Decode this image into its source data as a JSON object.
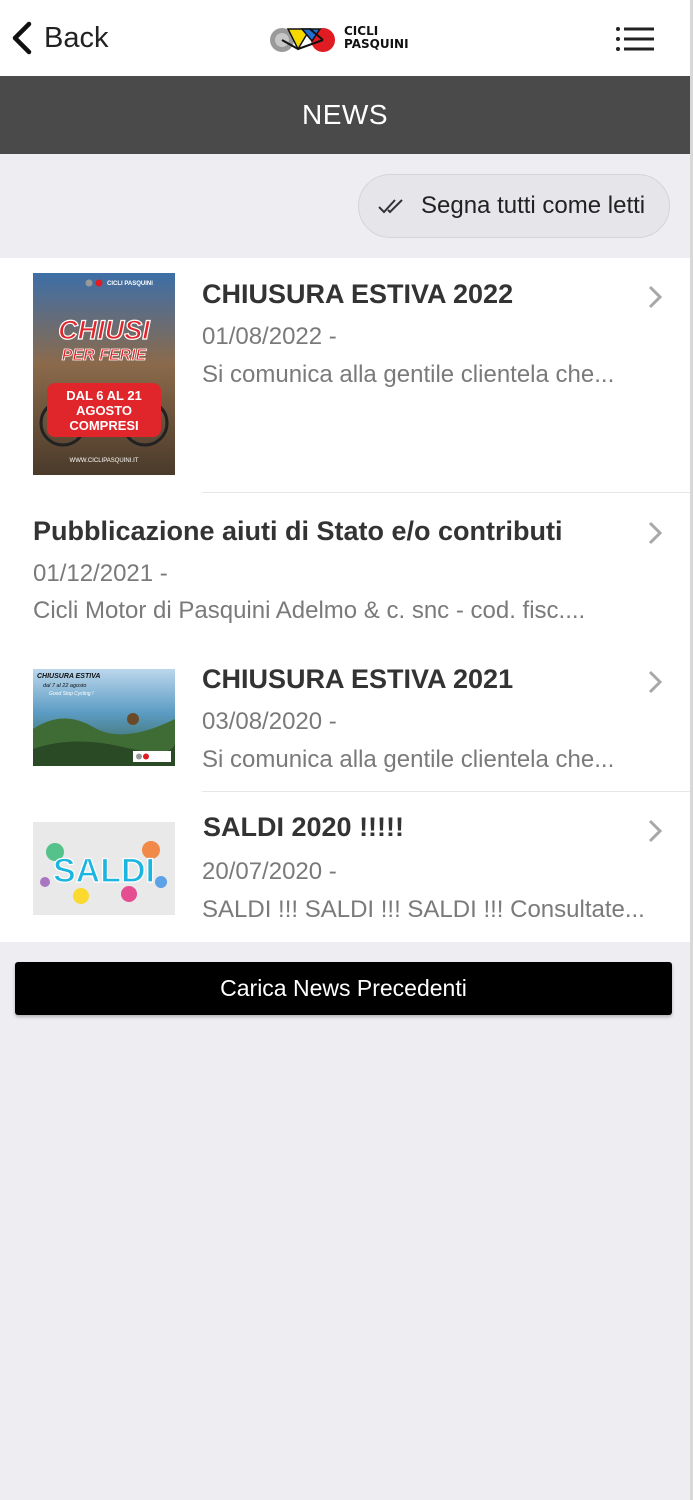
{
  "header": {
    "back_label": "Back",
    "logo_line1": "CICLI",
    "logo_line2": "PASQUINI"
  },
  "title_bar": {
    "title": "NEWS"
  },
  "mark_all_label": "Segna tutti come letti",
  "news": [
    {
      "title": "CHIUSURA ESTIVA 2022",
      "date": "01/08/2022 -",
      "summary": "Si comunica alla gentile clientela che...",
      "thumb": {
        "brand": "CICLI PASQUINI",
        "line1": "CHIUSI",
        "line2": "PER FERIE",
        "badge1": "DAL 6 AL 21",
        "badge2": "AGOSTO",
        "badge3": "COMPRESI",
        "footer": "WWW.CICLIPASQUINI.IT"
      }
    },
    {
      "title": "Pubblicazione aiuti di Stato e/o contributi",
      "date": "01/12/2021 -",
      "summary": "Cicli Motor di Pasquini Adelmo & c. snc - cod. fisc...."
    },
    {
      "title": "CHIUSURA ESTIVA 2021",
      "date": "03/08/2020 -",
      "summary": "Si comunica alla gentile clientela che...",
      "thumb": {
        "line1": "CHIUSURA ESTIVA",
        "line2": "dal 7 al 22 agosto",
        "line3": "Good Stop Cycling !"
      }
    },
    {
      "title": "SALDI 2020 !!!!!",
      "date": "20/07/2020 -",
      "summary": "SALDI !!! SALDI !!! SALDI !!! Consultate...",
      "thumb": {
        "text": "SALDI"
      }
    }
  ],
  "load_more_label": "Carica News Precedenti",
  "colors": {
    "title_bar_bg": "#4a4a4a",
    "page_bg": "#eeedf2",
    "load_more_bg": "#000000",
    "poster_red": "#e1262b"
  }
}
